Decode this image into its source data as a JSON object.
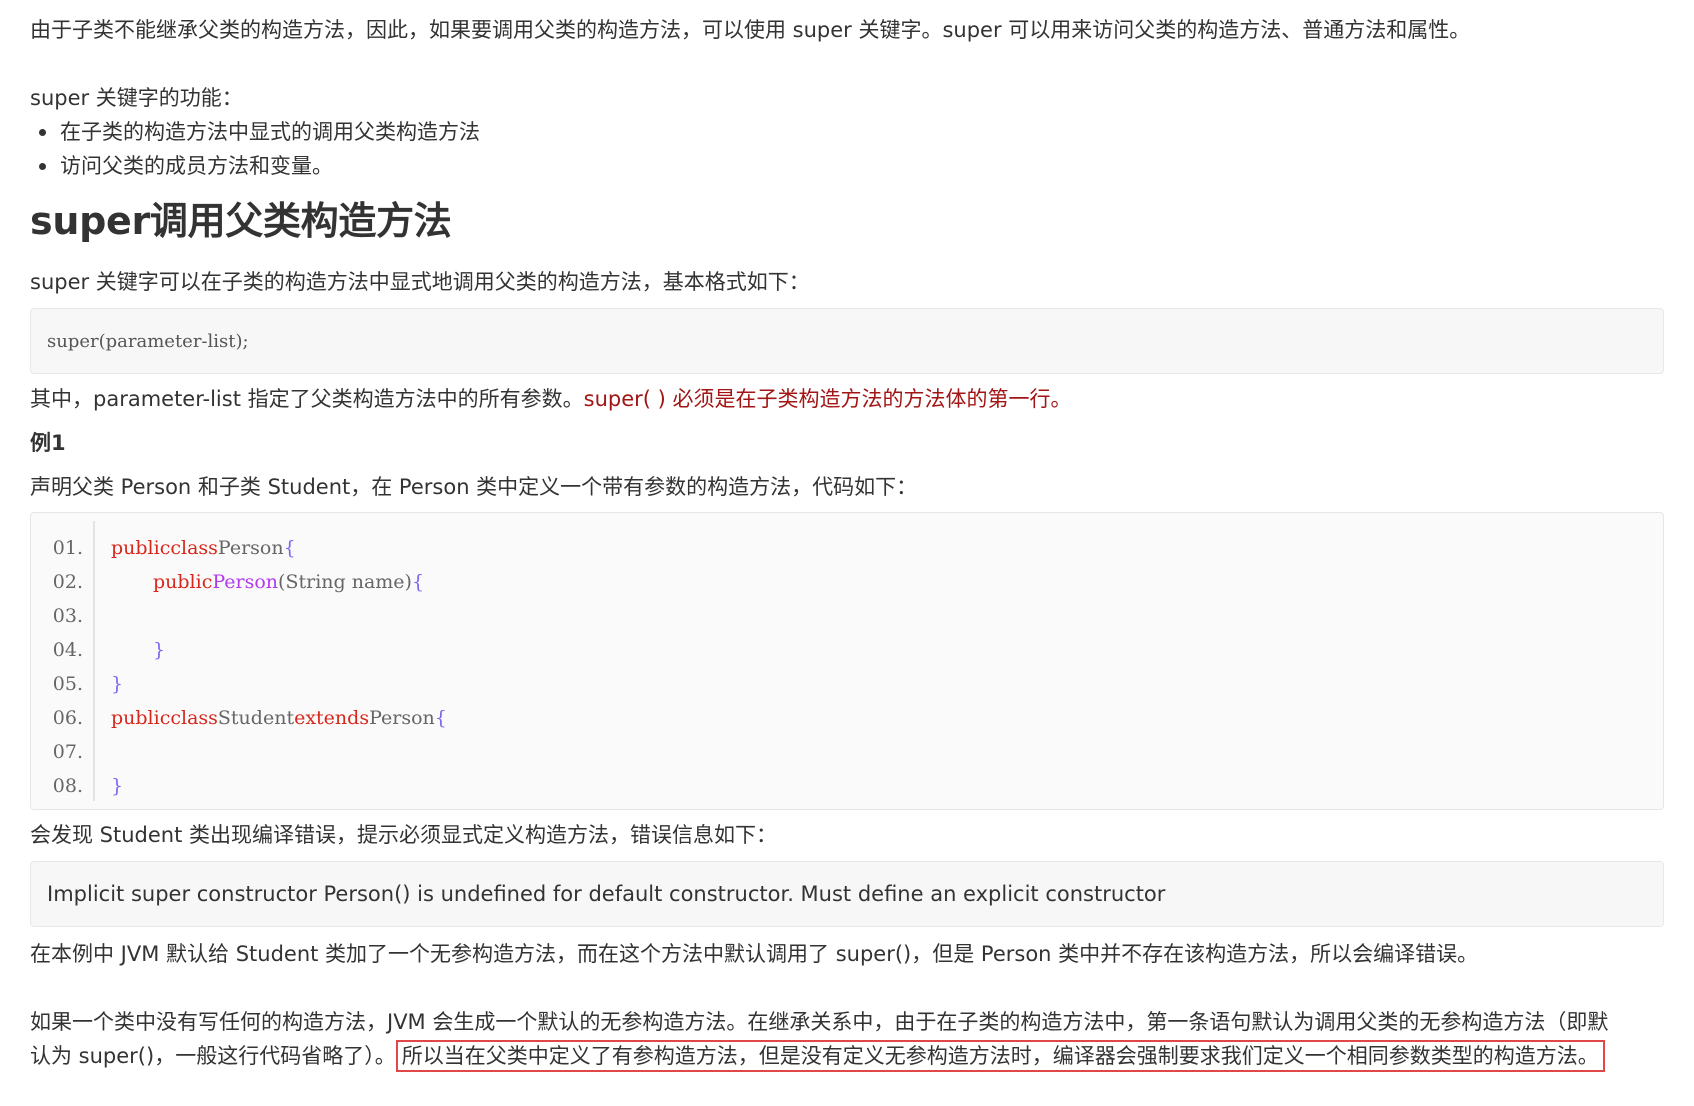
{
  "intro": "由于子类不能继承父类的构造方法，因此，如果要调用父类的构造方法，可以使用 super 关键字。super 可以用来访问父类的构造方法、普通方法和属性。",
  "features": {
    "label": "super 关键字的功能：",
    "items": [
      "在子类的构造方法中显式的调用父类构造方法",
      "访问父类的成员方法和变量。"
    ]
  },
  "section": {
    "title": "super调用父类构造方法",
    "subtitle": "super 关键字可以在子类的构造方法中显式地调用父类的构造方法，基本格式如下：",
    "syntax": "super(parameter-list);",
    "note_plain": "其中，parameter-list 指定了父类构造方法中的所有参数。",
    "note_red": "super( ) 必须是在子类构造方法的方法体的第一行。"
  },
  "example": {
    "label": "例1",
    "description": "声明父类 Person 和子类 Student，在 Person 类中定义一个带有参数的构造方法，代码如下：",
    "line_numbers": [
      "01.",
      "02.",
      "03.",
      "04.",
      "05.",
      "06.",
      "07.",
      "08."
    ],
    "code": {
      "l1": {
        "kw1": "public",
        "kw2": "class",
        "name": "Person",
        "brace": "{"
      },
      "l2": {
        "kw1": "public",
        "fn": "Person",
        "params": "(String name)",
        "brace": "{"
      },
      "l4": {
        "brace": "}"
      },
      "l5": {
        "brace": "}"
      },
      "l6": {
        "kw1": "public",
        "kw2": "class",
        "name": "Student",
        "kw3": "extends",
        "parent": "Person",
        "brace": "{"
      },
      "l8": {
        "brace": "}"
      }
    }
  },
  "after_code": "会发现 Student 类出现编译错误，提示必须显式定义构造方法，错误信息如下：",
  "error_message": "Implicit super constructor Person() is undefined for default constructor. Must define an explicit constructor",
  "jvm_explanation": "在本例中 JVM 默认给 Student 类加了一个无参构造方法，而在这个方法中默认调用了 super()，但是 Person 类中并不存在该构造方法，所以会编译错误。",
  "final_paragraph": {
    "line1": "如果一个类中没有写任何的构造方法，JVM 会生成一个默认的无参构造方法。在继承关系中，由于在子类的构造方法中，第一条语句默认为调用父类的无参构造方法（即默",
    "line2_plain": "认为 super()，一般这行代码省略了）。",
    "line2_highlighted": "所以当在父类中定义了有参构造方法，但是没有定义无参构造方法时，编译器会强制要求我们定义一个相同参数类型的构造方法。"
  },
  "colors": {
    "keyword": "#d7261b",
    "function": "#b23aee",
    "brace": "#7b68ee",
    "emphasis_red": "#a31515",
    "highlight_border": "#e04848"
  }
}
